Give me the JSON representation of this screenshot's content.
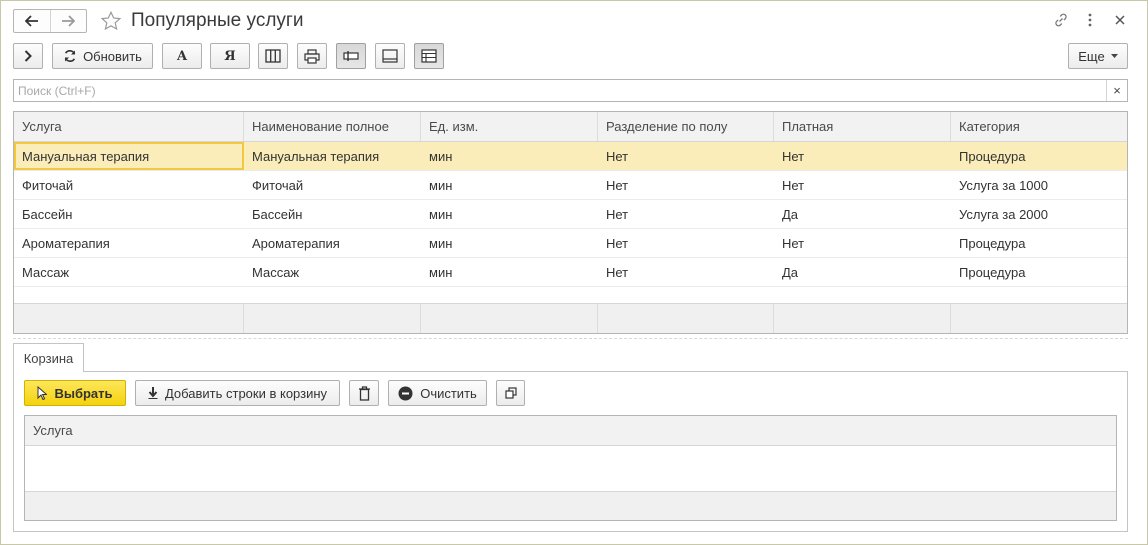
{
  "window": {
    "title": "Популярные услуги",
    "icons": [
      "back-arrow-icon",
      "forward-arrow-icon",
      "star-icon",
      "link-icon",
      "more-vertical-icon",
      "close-icon"
    ]
  },
  "toolbar": {
    "refresh_label": "Обновить",
    "font_a_label": "А",
    "font_ya_label": "Я",
    "more_label": "Еще"
  },
  "search": {
    "placeholder": "Поиск (Ctrl+F)",
    "clear_label": "×"
  },
  "main_table": {
    "columns": [
      "Услуга",
      "Наименование полное",
      "Ед. изм.",
      "Разделение по полу",
      "Платная",
      "Категория"
    ],
    "rows": [
      [
        "Мануальная терапия",
        "Мануальная терапия",
        "мин",
        "Нет",
        "Нет",
        "Процедура"
      ],
      [
        "Фиточай",
        "Фиточай",
        "мин",
        "Нет",
        "Нет",
        "Услуга за 1000"
      ],
      [
        "Бассейн",
        "Бассейн",
        "мин",
        "Нет",
        "Да",
        "Услуга за 2000"
      ],
      [
        "Ароматерапия",
        "Ароматерапия",
        "мин",
        "Нет",
        "Нет",
        "Процедура"
      ],
      [
        "Массаж",
        "Массаж",
        "мин",
        "Нет",
        "Да",
        "Процедура"
      ]
    ],
    "selected_row": 0
  },
  "basket": {
    "tab_label": "Корзина",
    "select_label": "Выбрать",
    "add_rows_label": "Добавить строки в корзину",
    "clear_label": "Очистить",
    "columns": [
      "Услуга"
    ]
  },
  "colors": {
    "selected_row": "#fbedb9",
    "focus_border": "#f3c740",
    "primary_button": "#f5d20e"
  }
}
